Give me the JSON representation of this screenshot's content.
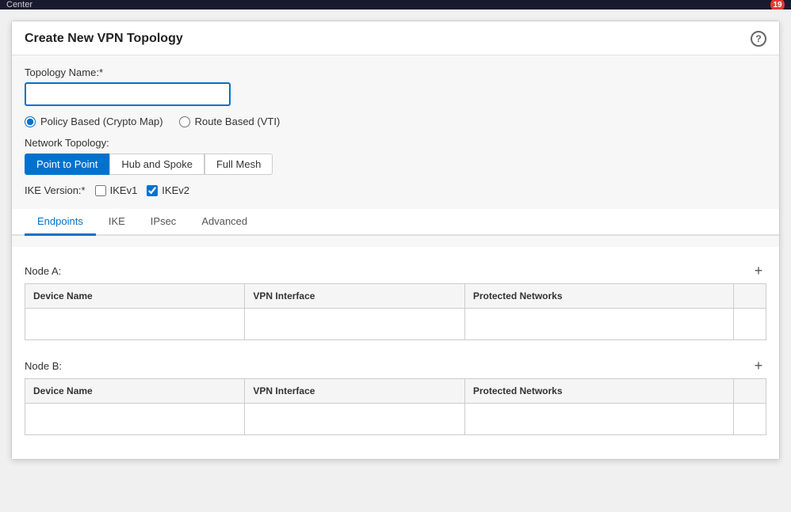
{
  "topBar": {
    "title": "Center",
    "notificationCount": "19"
  },
  "modal": {
    "title": "Create New VPN Topology",
    "helpIcon": "?"
  },
  "form": {
    "topologyNameLabel": "Topology Name:*",
    "topologyNameValue": "",
    "topologyNamePlaceholder": "",
    "radioOptions": [
      {
        "id": "policy-based",
        "label": "Policy Based (Crypto Map)",
        "checked": true
      },
      {
        "id": "route-based",
        "label": "Route Based (VTI)",
        "checked": false
      }
    ],
    "networkTopologyLabel": "Network Topology:",
    "topologyButtons": [
      {
        "label": "Point to Point",
        "active": true
      },
      {
        "label": "Hub and Spoke",
        "active": false
      },
      {
        "label": "Full Mesh",
        "active": false
      }
    ],
    "ikeVersionLabel": "IKE Version:*",
    "ikeOptions": [
      {
        "id": "ikev1",
        "label": "IKEv1",
        "checked": false
      },
      {
        "id": "ikev2",
        "label": "IKEv2",
        "checked": true
      }
    ]
  },
  "tabs": [
    {
      "label": "Endpoints",
      "active": true
    },
    {
      "label": "IKE",
      "active": false
    },
    {
      "label": "IPsec",
      "active": false
    },
    {
      "label": "Advanced",
      "active": false
    }
  ],
  "nodeA": {
    "label": "Node A:",
    "addIcon": "+",
    "table": {
      "columns": [
        "Device Name",
        "VPN Interface",
        "Protected Networks",
        ""
      ],
      "rows": []
    }
  },
  "nodeB": {
    "label": "Node B:",
    "addIcon": "+",
    "table": {
      "columns": [
        "Device Name",
        "VPN Interface",
        "Protected Networks",
        ""
      ],
      "rows": []
    }
  }
}
